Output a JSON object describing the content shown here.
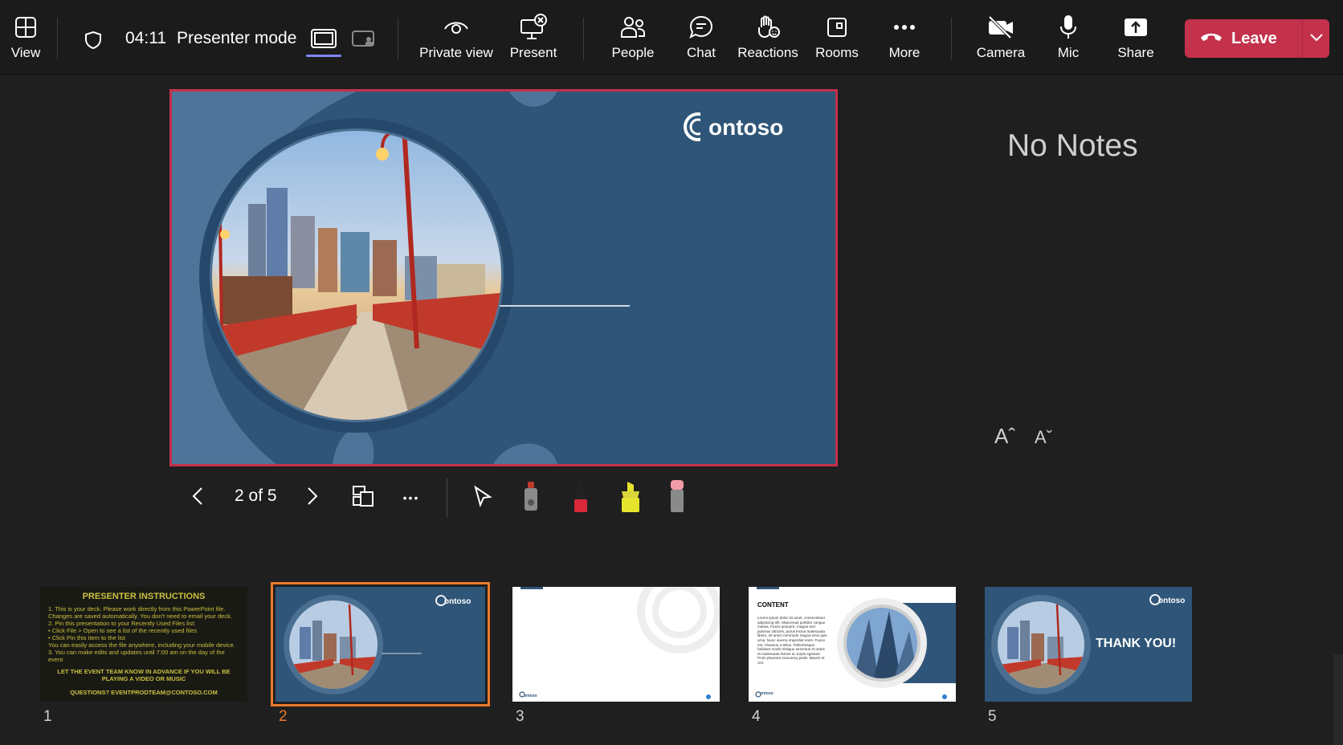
{
  "topbar": {
    "view_label": "View",
    "timer": "04:11",
    "mode_label": "Presenter mode",
    "private_view_label": "Private view",
    "present_label": "Present",
    "people_label": "People",
    "chat_label": "Chat",
    "reactions_label": "Reactions",
    "rooms_label": "Rooms",
    "more_label": "More",
    "camera_label": "Camera",
    "mic_label": "Mic",
    "share_label": "Share",
    "leave_label": "Leave"
  },
  "slide": {
    "logo_text": "ontoso"
  },
  "notes": {
    "title": "No Notes",
    "increase_font_glyph": "Aˆ",
    "decrease_font_glyph": "Aˇ"
  },
  "controls": {
    "counter": "2 of 5",
    "more_glyph": "•••"
  },
  "thumbnails": [
    {
      "number": "1",
      "title": "PRESENTER INSTRUCTIONS",
      "lines": [
        "1. This is your deck. Please work directly from this PowerPoint file.",
        "Changes are saved automatically. You don't need to email your deck.",
        "2. Pin this presentation to your Recently Used Files list:",
        "• Click File > Open to see a list of the recently used files",
        "• Click Pin this item to the list",
        "You can easily access the file anywhere, including your mobile device.",
        "3. You can make edits and updates until 7:00 am on the day of the event"
      ],
      "callout": "LET THE EVENT TEAM KNOW IN ADVANCE IF YOU WILL BE PLAYING A VIDEO OR MUSIC",
      "contact": "QUESTIONS? EVENTPRODTEAM@CONTOSO.COM"
    },
    {
      "number": "2",
      "logo": "ontoso"
    },
    {
      "number": "3",
      "logo": "ontoso"
    },
    {
      "number": "4",
      "heading": "CONTENT",
      "body": "Lorem ipsum dolor sit amet, consectetuer adipiscing elit. Maecenas porttitor congue massa. Fusce posuere, magna sed pulvinar ultricies, purus lectus malesuada libero, sit amet commodo magna eros quis urna. Nunc viverra imperdiet enim. Fusce est. Vivamus a tellus. Pellentesque habitant morbi tristique senectus et netus et malesuada fames ac turpis egestas. Proin pharetra nonummy pede. Mauris et orci.",
      "logo": "ontoso"
    },
    {
      "number": "5",
      "title": "THANK YOU!",
      "logo": "ontoso"
    }
  ],
  "colors": {
    "leave": "#c4314b",
    "slide_blue": "#2f5578",
    "selection": "#e97a2c",
    "accent": "#7f85f5"
  }
}
